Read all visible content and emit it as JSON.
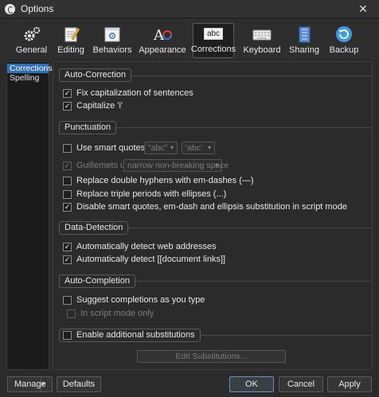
{
  "window": {
    "title": "Options",
    "close_glyph": "✕"
  },
  "toolbar": {
    "items": [
      {
        "label": "General",
        "icon": "gears-icon"
      },
      {
        "label": "Editing",
        "icon": "pencil-note-icon"
      },
      {
        "label": "Behaviors",
        "icon": "behaviors-icon"
      },
      {
        "label": "Appearance",
        "icon": "font-color-icon"
      },
      {
        "label": "Corrections",
        "icon": "abc-icon",
        "icon_text": "abc",
        "active": true
      },
      {
        "label": "Keyboard",
        "icon": "keyboard-icon"
      },
      {
        "label": "Sharing",
        "icon": "binder-icon"
      },
      {
        "label": "Backup",
        "icon": "backup-icon"
      }
    ]
  },
  "sidebar": {
    "items": [
      {
        "label": "Corrections",
        "selected": true
      },
      {
        "label": "Spelling",
        "selected": false
      }
    ]
  },
  "auto_correction": {
    "title": "Auto-Correction",
    "fix_capitalization": {
      "label": "Fix capitalization of sentences",
      "checked": true
    },
    "capitalize_i": {
      "label": "Capitalize 'i'",
      "checked": true
    }
  },
  "punctuation": {
    "title": "Punctuation",
    "smart_quotes": {
      "label": "Use smart quotes (\" \")",
      "checked": false,
      "double_value": "\"abc\"",
      "single_value": "'abc'"
    },
    "guillemets": {
      "label": "Guillemets use",
      "checked": true,
      "disabled": true,
      "value": "narrow non-breaking space"
    },
    "em_dashes": {
      "label": "Replace double hyphens with em-dashes (—)",
      "checked": false
    },
    "ellipses": {
      "label": "Replace triple periods with ellipses (...)",
      "checked": false
    },
    "disable_script": {
      "label": "Disable smart quotes, em-dash and ellipsis substitution in script mode",
      "checked": true
    }
  },
  "data_detection": {
    "title": "Data-Detection",
    "web_addresses": {
      "label": "Automatically detect web addresses",
      "checked": true
    },
    "document_links": {
      "label": "Automatically detect [[document links]]",
      "checked": true
    }
  },
  "auto_completion": {
    "title": "Auto-Completion",
    "suggest": {
      "label": "Suggest completions as you type",
      "checked": false
    },
    "script_mode_only": {
      "label": "In script mode only",
      "checked": false,
      "disabled": true
    }
  },
  "substitutions": {
    "enable": {
      "label": "Enable additional substitutions",
      "checked": false
    },
    "edit_button": "Edit Substitutions..."
  },
  "footer": {
    "manage": "Manage",
    "manage_arrow": "▾",
    "defaults": "Defaults",
    "ok": "OK",
    "cancel": "Cancel",
    "apply": "Apply"
  },
  "check_glyph": "✓",
  "dropdown_arrow": "▾"
}
